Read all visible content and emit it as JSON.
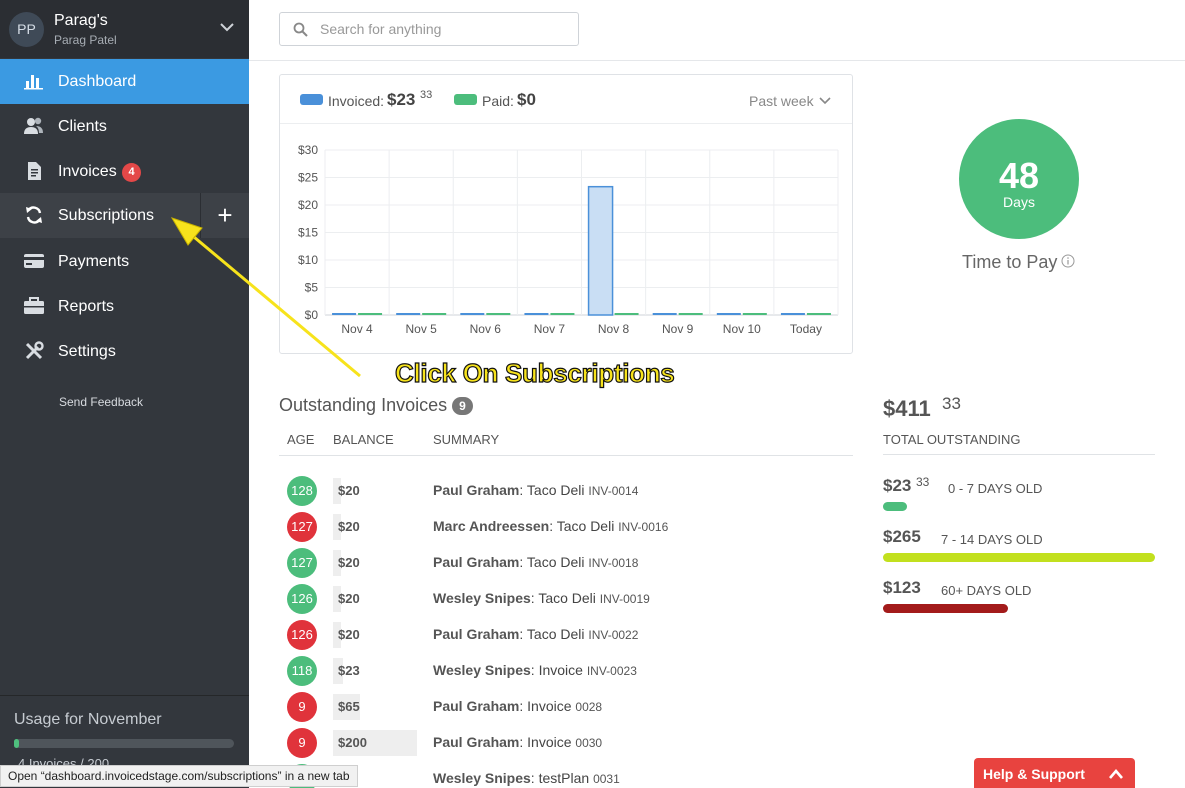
{
  "account": {
    "avatar": "PP",
    "name": "Parag's",
    "user": "Parag Patel"
  },
  "nav": [
    {
      "label": "Dashboard",
      "icon": "bar-chart-icon"
    },
    {
      "label": "Clients",
      "icon": "users-icon"
    },
    {
      "label": "Invoices",
      "icon": "document-icon",
      "badge": "4"
    },
    {
      "label": "Subscriptions",
      "icon": "refresh-icon"
    },
    {
      "label": "Payments",
      "icon": "credit-card-icon"
    },
    {
      "label": "Reports",
      "icon": "briefcase-icon"
    },
    {
      "label": "Settings",
      "icon": "tools-icon"
    }
  ],
  "subscriptions_add": "+",
  "send_feedback": "Send Feedback",
  "usage": {
    "title": "Usage for November",
    "text": "4 Invoices / 200",
    "used": 4,
    "limit": 200
  },
  "search": {
    "placeholder": "Search for anything"
  },
  "chart_legend": {
    "invoiced_label": "Invoiced:",
    "invoiced_value": "$23",
    "invoiced_cents": "33",
    "paid_label": "Paid:",
    "paid_value": "$0",
    "range": "Past week"
  },
  "chart_data": {
    "type": "bar",
    "categories": [
      "Nov 4",
      "Nov 5",
      "Nov 6",
      "Nov 7",
      "Nov 8",
      "Nov 9",
      "Nov 10",
      "Today"
    ],
    "series": [
      {
        "name": "Invoiced",
        "values": [
          0,
          0,
          0,
          0,
          23.33,
          0,
          0,
          0
        ],
        "color": "#4a90d9"
      },
      {
        "name": "Paid",
        "values": [
          0,
          0,
          0,
          0,
          0,
          0,
          0,
          0
        ],
        "color": "#4cbd7c"
      }
    ],
    "yticks": [
      "$30",
      "$25",
      "$20",
      "$15",
      "$10",
      "$5",
      "$0"
    ],
    "ylim": [
      0,
      30
    ],
    "grid": true
  },
  "time_to_pay": {
    "value": "48",
    "unit": "Days",
    "label": "Time to Pay"
  },
  "annotation": "Click On Subscriptions",
  "outstanding": {
    "title": "Outstanding Invoices",
    "count": "9",
    "headers": {
      "age": "AGE",
      "balance": "BALANCE",
      "summary": "SUMMARY"
    },
    "rows": [
      {
        "age": "128",
        "status": "green",
        "balance": "$20",
        "amount": 20,
        "client": "Paul Graham",
        "desc": ": Taco Deli ",
        "number": "INV-0014"
      },
      {
        "age": "127",
        "status": "red",
        "balance": "$20",
        "amount": 20,
        "client": "Marc Andreessen",
        "desc": ": Taco Deli ",
        "number": "INV-0016"
      },
      {
        "age": "127",
        "status": "green",
        "balance": "$20",
        "amount": 20,
        "client": "Paul Graham",
        "desc": ": Taco Deli ",
        "number": "INV-0018"
      },
      {
        "age": "126",
        "status": "green",
        "balance": "$20",
        "amount": 20,
        "client": "Wesley Snipes",
        "desc": ": Taco Deli ",
        "number": "INV-0019"
      },
      {
        "age": "126",
        "status": "red",
        "balance": "$20",
        "amount": 20,
        "client": "Paul Graham",
        "desc": ": Taco Deli ",
        "number": "INV-0022"
      },
      {
        "age": "118",
        "status": "green",
        "balance": "$23",
        "amount": 23,
        "client": "Wesley Snipes",
        "desc": ": Invoice ",
        "number": "INV-0023"
      },
      {
        "age": "9",
        "status": "red",
        "balance": "$65",
        "amount": 65,
        "client": "Paul Graham",
        "desc": ": Invoice ",
        "number": "0028"
      },
      {
        "age": "9",
        "status": "red",
        "balance": "$200",
        "amount": 200,
        "client": "Paul Graham",
        "desc": ": Invoice ",
        "number": "0030"
      },
      {
        "age": "",
        "status": "green",
        "balance": "",
        "amount": 0,
        "client": "Wesley Snipes",
        "desc": ": testPlan ",
        "number": "0031"
      }
    ]
  },
  "totals": {
    "amount": "$411",
    "cents": "33",
    "label": "TOTAL OUTSTANDING",
    "aging": [
      {
        "amount": "$23",
        "cents": "33",
        "label": "0 - 7 DAYS OLD",
        "color": "#4cbd7c",
        "fraction": 0.09
      },
      {
        "amount": "$265",
        "cents": "",
        "label": "7 - 14 DAYS OLD",
        "color": "#c2e01e",
        "fraction": 1.0
      },
      {
        "amount": "$123",
        "cents": "",
        "label": "60+ DAYS OLD",
        "color": "#a31b1b",
        "fraction": 0.46
      }
    ]
  },
  "status_url": "Open “dashboard.invoicedstage.com/subscriptions” in a new tab",
  "help": "Help & Support"
}
